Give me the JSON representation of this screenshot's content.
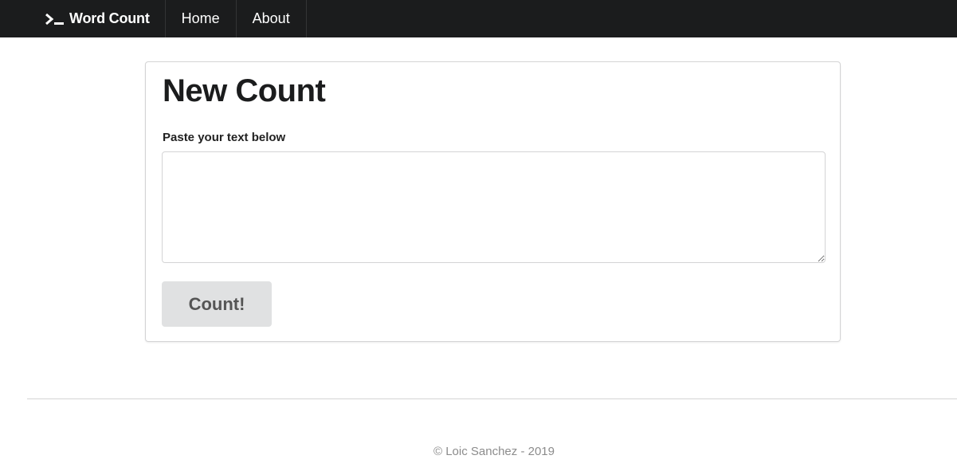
{
  "navbar": {
    "brand_label": "Word Count",
    "brand_icon": "terminal-icon",
    "items": [
      {
        "label": "Home"
      },
      {
        "label": "About"
      }
    ]
  },
  "form": {
    "title": "New Count",
    "field_label": "Paste your text below",
    "textarea_value": "",
    "submit_label": "Count!"
  },
  "footer": {
    "text": "© Loic Sanchez - 2019"
  },
  "colors": {
    "navbar_bg": "#1b1c1d",
    "button_bg": "#e0e1e2",
    "footer_text": "#8c8c8c"
  }
}
